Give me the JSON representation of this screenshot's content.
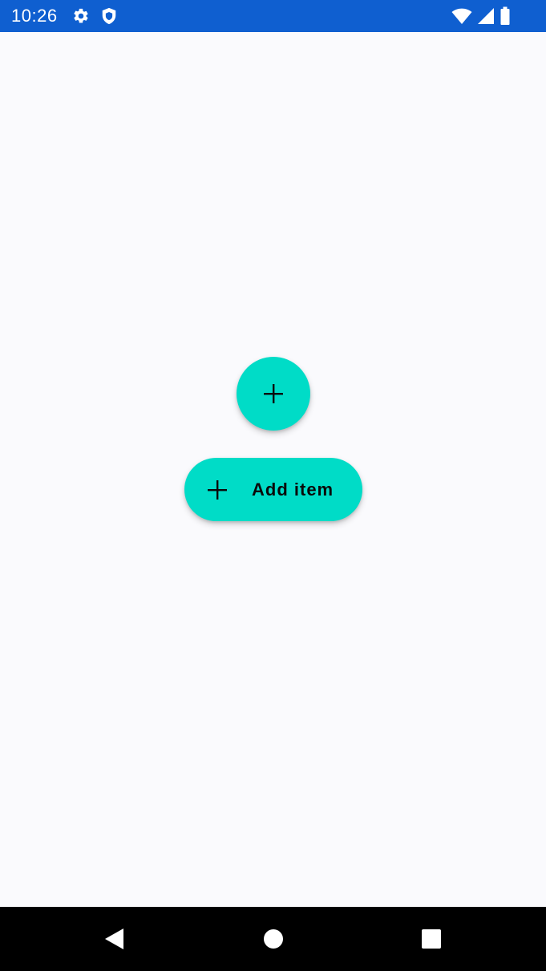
{
  "status_bar": {
    "time": "10:26",
    "background_color": "#0f5fd0",
    "left_icons": [
      "settings-gear-icon",
      "shield-icon"
    ],
    "right_icons": [
      "wifi-icon",
      "signal-icon",
      "battery-icon"
    ]
  },
  "main": {
    "fab": {
      "icon": "plus-icon",
      "color": "#00dcc7"
    },
    "extended_fab": {
      "icon": "plus-icon",
      "label": "Add item",
      "color": "#00dcc7"
    }
  },
  "nav_bar": {
    "buttons": [
      "back-icon",
      "home-icon",
      "recents-icon"
    ]
  }
}
